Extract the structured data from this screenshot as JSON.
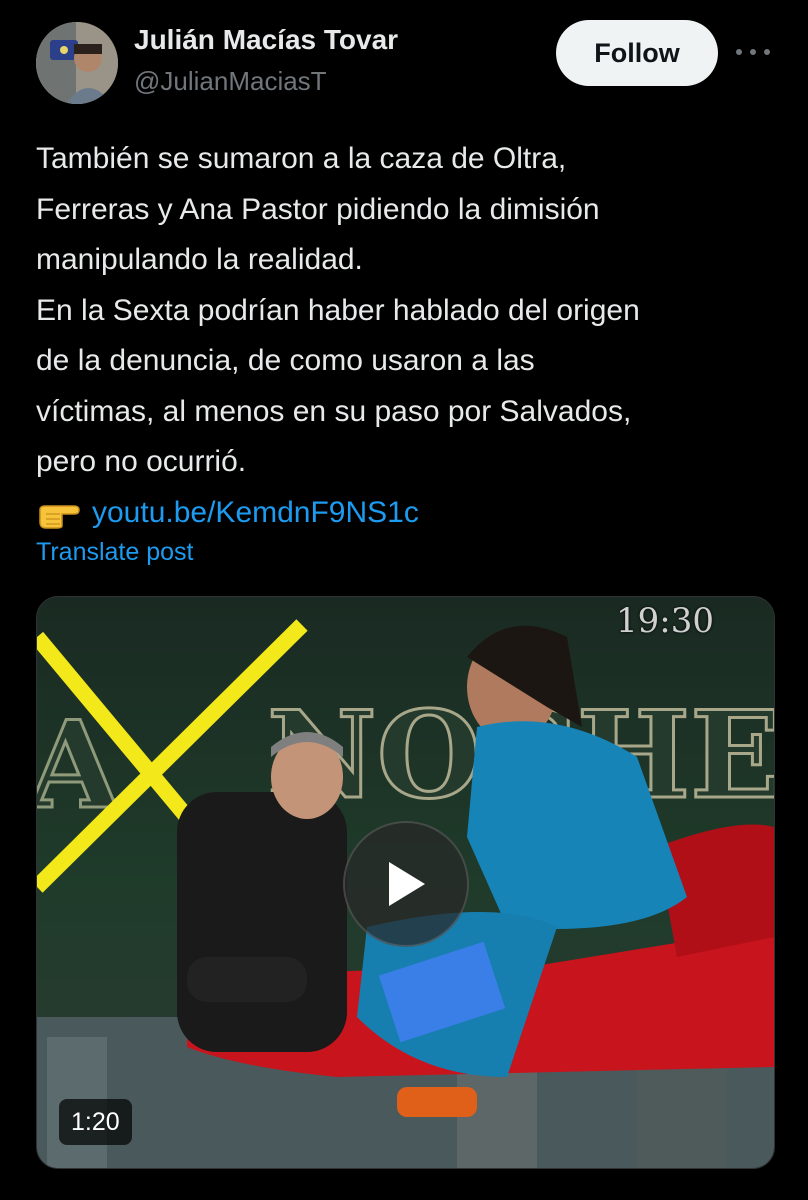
{
  "author": {
    "name": "Julián Macías Tovar",
    "handle": "@JulianMaciasT"
  },
  "actions": {
    "follow_label": "Follow",
    "more_icon": "more-horizontal-icon"
  },
  "post": {
    "lines": [
      "También se sumaron a la caza de Oltra,",
      "Ferreras y Ana Pastor pidiendo la dimisión",
      "manipulando la realidad.",
      "En la Sexta podrían haber hablado del origen",
      "de la denuncia, de como usaron a las",
      "víctimas, al menos en su paso por Salvados,",
      "pero no ocurrió."
    ],
    "emoji": "pointing-right-hand-icon",
    "link": "youtu.be/KemdnF9NS1c",
    "translate_label": "Translate post"
  },
  "video": {
    "timestamp": "19:30",
    "duration": "1:20",
    "play_icon": "play-icon",
    "colors": {
      "background_green": "#1f3b2a",
      "yellow_x": "#f2e81a",
      "sofa_red": "#c8141c",
      "dress_blue": "#1784b8"
    }
  }
}
